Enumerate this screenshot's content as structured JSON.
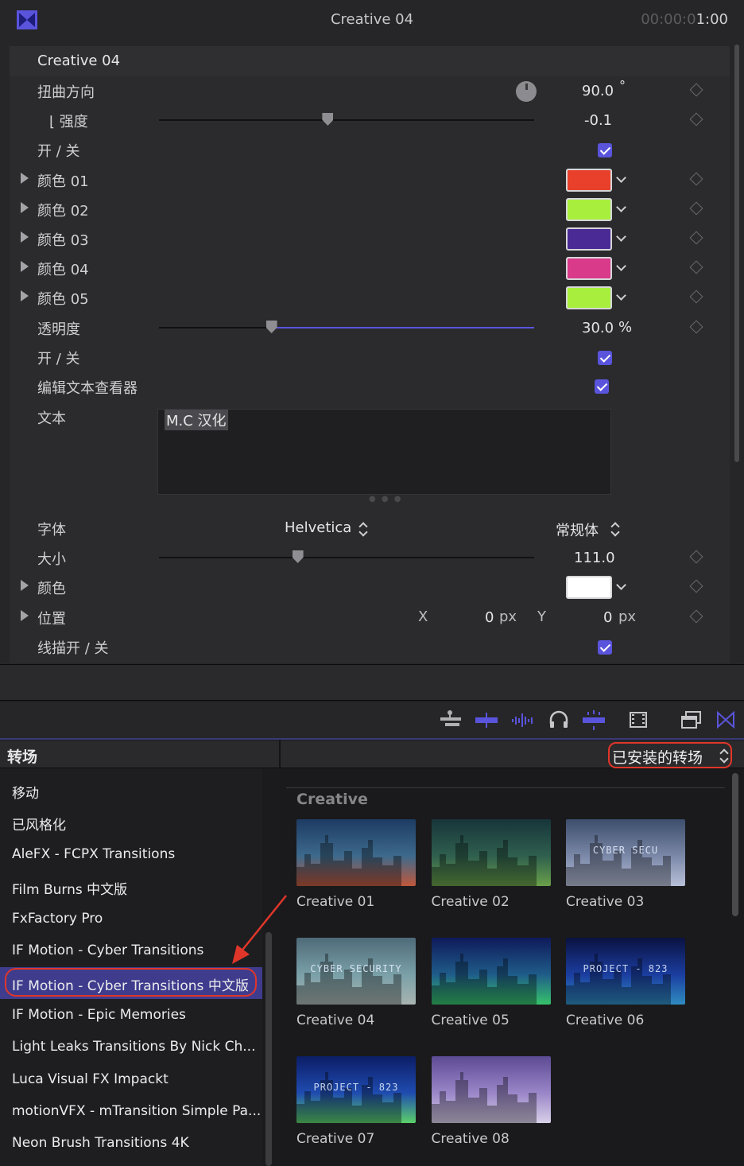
{
  "inspector": {
    "title": "Creative 04",
    "timecode_dim": "00:00:0",
    "timecode_lit": "1:00",
    "section_title": "Creative 04",
    "rows": {
      "twist_direction": {
        "label": "扭曲方向",
        "value": "90.0",
        "unit": "°"
      },
      "strength": {
        "label": "⌊ 强度",
        "value": "-0.1",
        "slider_fraction": 0.45
      },
      "toggle1": {
        "label": "开 / 关",
        "checked": true
      },
      "color01": {
        "label": "颜色 01",
        "color": "#e8402a"
      },
      "color02": {
        "label": "颜色 02",
        "color": "#a7ef3c"
      },
      "color03": {
        "label": "颜色 03",
        "color": "#4a2a94"
      },
      "color04": {
        "label": "颜色 04",
        "color": "#d93a8a"
      },
      "color05": {
        "label": "颜色 05",
        "color": "#a7ef3c"
      },
      "opacity": {
        "label": "透明度",
        "value": "30.0",
        "unit": "%",
        "slider_fraction": 0.3
      },
      "toggle2": {
        "label": "开 / 关",
        "checked": true
      },
      "edit_text_viewer": {
        "label": "编辑文本查看器",
        "checked": true
      },
      "text": {
        "label": "文本",
        "value": "M.C 汉化"
      },
      "font": {
        "label": "字体",
        "family": "Helvetica",
        "style": "常规体"
      },
      "size": {
        "label": "大小",
        "value": "111.0",
        "slider_fraction": 0.37
      },
      "color": {
        "label": "颜色",
        "color": "#ffffff"
      },
      "position": {
        "label": "位置",
        "x_label": "X",
        "x_value": "0",
        "y_label": "Y",
        "y_value": "0",
        "unit": "px"
      },
      "stroke": {
        "label": "线描开 / 关",
        "checked": true
      }
    }
  },
  "toolbar": {
    "icons": [
      "connect-clip-icon",
      "insert-clip-icon",
      "audio-waveform-icon",
      "headphones-icon",
      "split-clip-icon",
      "filmstrip-icon",
      "window-layout-icon",
      "transitions-browser-icon"
    ],
    "accent": "#5a54dd"
  },
  "browser": {
    "title": "转场",
    "installed_menu": "已安装的转场",
    "sidebar": [
      "移动",
      "已风格化",
      "AleFX - FCPX Transitions",
      "Film Burns 中文版",
      "FxFactory Pro",
      "IF Motion - Cyber Transitions",
      "IF Motion - Cyber Transitions 中文版",
      "IF Motion - Epic Memories",
      "Light Leaks Transitions By Nick Ch...",
      "Luca Visual FX Impackt",
      "motionVFX - mTransition Simple Pa...",
      "Neon Brush Transitions 4K"
    ],
    "selected_index": 6,
    "category": "Creative",
    "thumbnails": [
      {
        "label": "Creative 01",
        "overlay": ""
      },
      {
        "label": "Creative 02",
        "overlay": ""
      },
      {
        "label": "Creative 03",
        "overlay": "CYBER SECU"
      },
      {
        "label": "Creative 04",
        "overlay": "CYBER SECURITY"
      },
      {
        "label": "Creative 05",
        "overlay": ""
      },
      {
        "label": "Creative 06",
        "overlay": "PROJECT - 823"
      },
      {
        "label": "Creative 07",
        "overlay": "PROJECT - 823"
      },
      {
        "label": "Creative 08",
        "overlay": ""
      }
    ],
    "highlight_color": "#e0362a"
  }
}
